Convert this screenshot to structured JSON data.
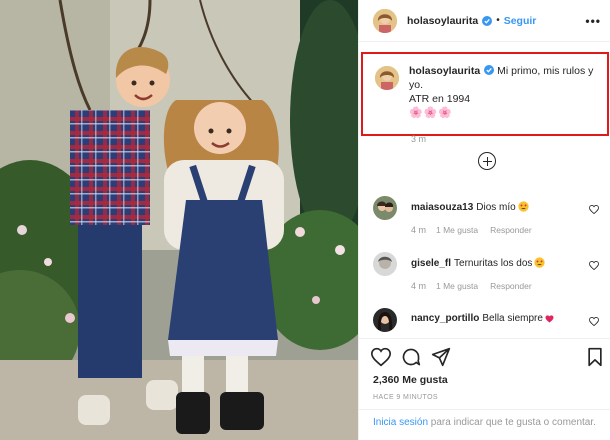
{
  "header": {
    "username": "holasoylaurita",
    "separator": "•",
    "follow_label": "Seguir",
    "more_icon": "more-options-icon"
  },
  "caption": {
    "username": "holasoylaurita",
    "line1": "Mi primo, mis rulos y",
    "line2": "yo.",
    "line3": "ATR en 1994",
    "flowers": "🌸🌸🌸",
    "time": "3 m",
    "highlight_color": "#e01919"
  },
  "load_more_icon": "plus-circle-icon",
  "comments": [
    {
      "username": "maiasouza13",
      "text": "Dios mío",
      "emoji": "heart-eyes-emoji",
      "time": "4 m",
      "likes": "1 Me gusta",
      "reply": "Responder"
    },
    {
      "username": "gisele_fl",
      "text": "Ternuritas los dos",
      "emoji": "heart-eyes-emoji",
      "time": "4 m",
      "likes": "1 Me gusta",
      "reply": "Responder"
    },
    {
      "username": "nancy_portillo",
      "text": "Bella siempre",
      "emoji": "red-heart-emoji"
    }
  ],
  "actions": {
    "like_icon": "heart-outline-icon",
    "comment_icon": "comment-bubble-icon",
    "share_icon": "paper-plane-icon",
    "save_icon": "bookmark-icon"
  },
  "likes_text": "2,360 Me gusta",
  "post_time": "HACE 9 MINUTOS",
  "login": {
    "link": "Inicia sesión",
    "text": " para indicar que te gusta o comentar."
  },
  "colors": {
    "link": "#3897f0",
    "text": "#262626",
    "muted": "#999999",
    "highlight": "#e01919"
  }
}
